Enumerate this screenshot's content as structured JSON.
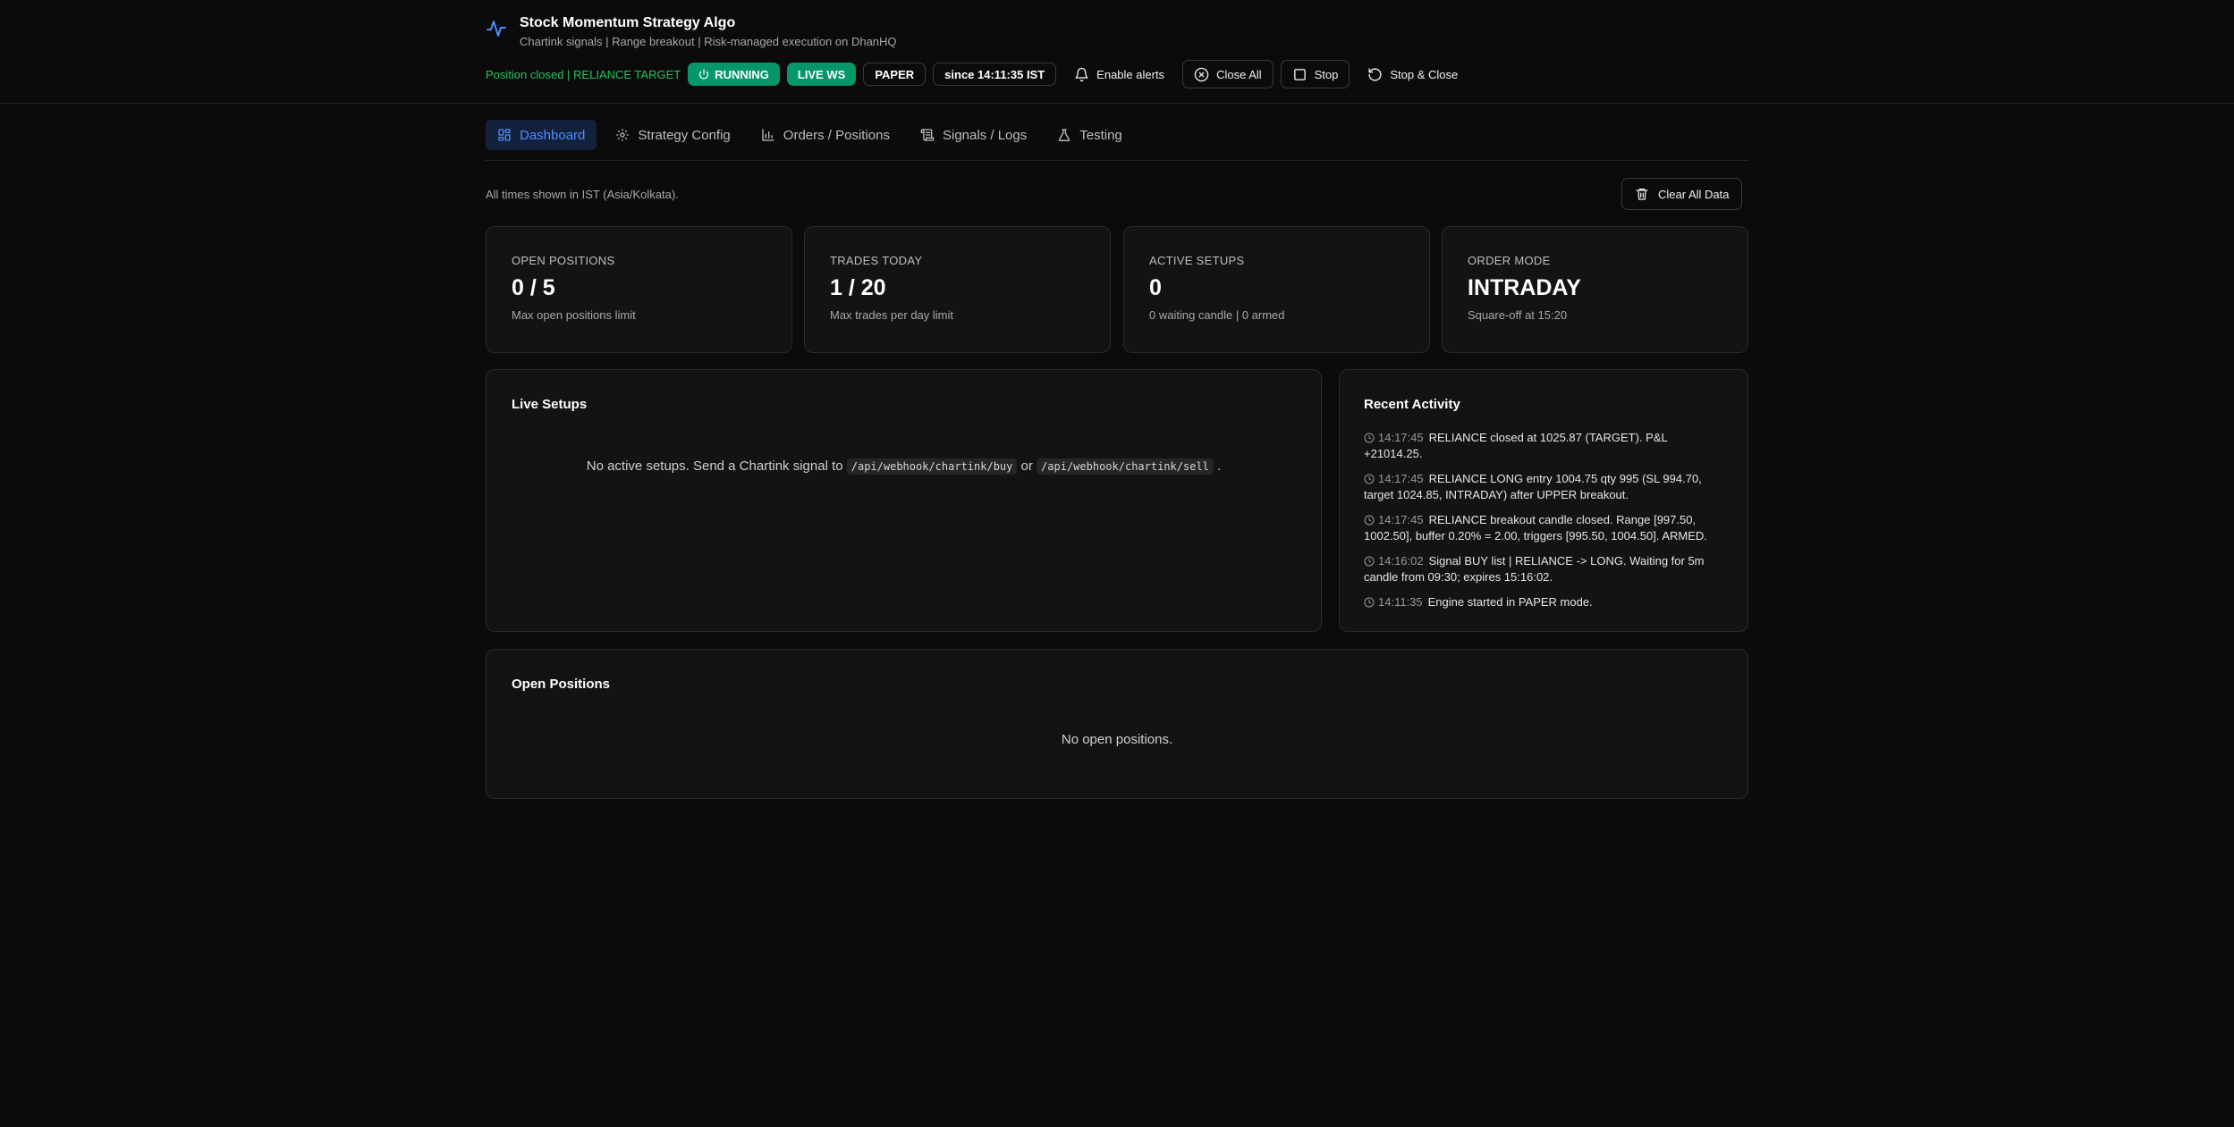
{
  "app": {
    "title": "Stock Momentum Strategy Algo",
    "subtitle": "Chartink signals | Range breakout | Risk-managed execution on DhanHQ",
    "accent": "#4c8dff"
  },
  "status": {
    "message": "Position closed | RELIANCE TARGET",
    "running_label": "RUNNING",
    "live_ws_label": "LIVE WS",
    "mode_label": "PAPER",
    "since_label": "since 14:11:35 IST",
    "green": "#059669"
  },
  "toolbar": {
    "alerts_label": "Enable alerts",
    "close_all_label": "Close All",
    "stop_label": "Stop",
    "stop_close_label": "Stop & Close"
  },
  "tabs": [
    {
      "label": "Dashboard",
      "icon": "grid-icon",
      "active": true
    },
    {
      "label": "Strategy Config",
      "icon": "gear-icon",
      "active": false
    },
    {
      "label": "Orders / Positions",
      "icon": "bar-chart-icon",
      "active": false
    },
    {
      "label": "Signals / Logs",
      "icon": "scroll-icon",
      "active": false
    },
    {
      "label": "Testing",
      "icon": "flask-icon",
      "active": false
    }
  ],
  "timezone_note": "All times shown in IST (Asia/Kolkata).",
  "clear_all_label": "Clear All Data",
  "stats": [
    {
      "label": "OPEN POSITIONS",
      "value": "0 / 5",
      "sub": "Max open positions limit"
    },
    {
      "label": "TRADES TODAY",
      "value": "1 / 20",
      "sub": "Max trades per day limit"
    },
    {
      "label": "ACTIVE SETUPS",
      "value": "0",
      "sub": "0 waiting candle | 0 armed"
    },
    {
      "label": "ORDER MODE",
      "value": "INTRADAY",
      "sub": "Square-off at 15:20"
    }
  ],
  "live_setups": {
    "title": "Live Setups",
    "empty_prefix": "No active setups. Send a Chartink signal to",
    "buy_path": "/api/webhook/chartink/buy",
    "or_text": "or",
    "sell_path": "/api/webhook/chartink/sell",
    "suffix": "."
  },
  "activity": {
    "title": "Recent Activity",
    "items": [
      {
        "time": "14:17:45",
        "text": "RELIANCE closed at 1025.87 (TARGET). P&L +21014.25."
      },
      {
        "time": "14:17:45",
        "text": "RELIANCE LONG entry 1004.75 qty 995 (SL 994.70, target 1024.85, INTRADAY) after UPPER breakout."
      },
      {
        "time": "14:17:45",
        "text": "RELIANCE breakout candle closed. Range [997.50, 1002.50], buffer 0.20% = 2.00, triggers [995.50, 1004.50]. ARMED."
      },
      {
        "time": "14:16:02",
        "text": "Signal BUY list | RELIANCE -> LONG. Waiting for 5m candle from 09:30; expires 15:16:02."
      },
      {
        "time": "14:11:35",
        "text": "Engine started in PAPER mode."
      }
    ]
  },
  "open_positions": {
    "title": "Open Positions",
    "empty": "No open positions."
  }
}
